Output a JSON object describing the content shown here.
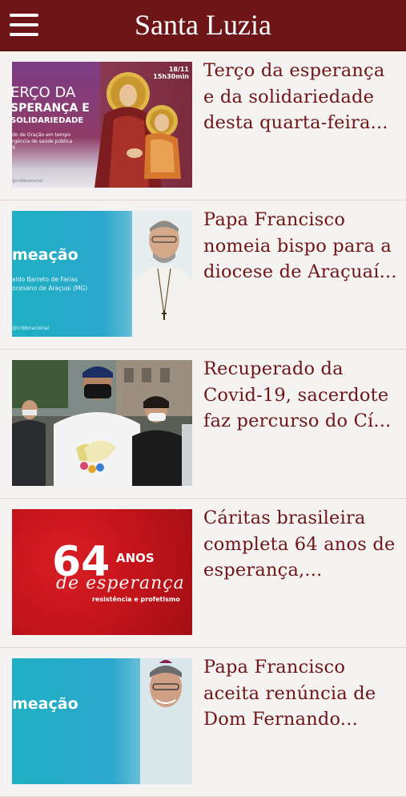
{
  "app": {
    "title": "Santa Luzia",
    "menu_icon": "hamburger-menu-icon",
    "colors": {
      "bar": "#6e1518",
      "headline": "#6e1518",
      "background": "#f5f3f1"
    }
  },
  "articles": [
    {
      "headline": "Terço da esperança e da solidariedade desta quarta-feira...",
      "thumb": {
        "lines": [
          "ERÇO DA",
          "SPERANÇA E",
          "SOLIDARIEDADE"
        ],
        "small": [
          "do de Oração em tempo",
          "rgência de saúde pública",
          "9"
        ],
        "date": [
          "18/11",
          "15h30min"
        ],
        "handle": "@cnbbnacional"
      }
    },
    {
      "headline": "Papa Francisco nomeia bispo para a diocese de Araçuaí...",
      "thumb": {
        "word": "meação",
        "sub": [
          "aldo Barreto de Farias",
          "ocesano de Araçuaí (MG)"
        ],
        "handle": "@cnbbnacional"
      }
    },
    {
      "headline": "Recuperado da Covid-19, sacerdote faz percurso do Cí..."
    },
    {
      "headline": "Cáritas brasileira completa 64 anos de esperança,...",
      "thumb": {
        "number": "64",
        "anos": "ANOS",
        "script": "de esperança",
        "tag": "resistência e profetismo"
      }
    },
    {
      "headline": "Papa Francisco aceita renúncia de Dom Fernando...",
      "thumb": {
        "word": "meação"
      }
    }
  ]
}
